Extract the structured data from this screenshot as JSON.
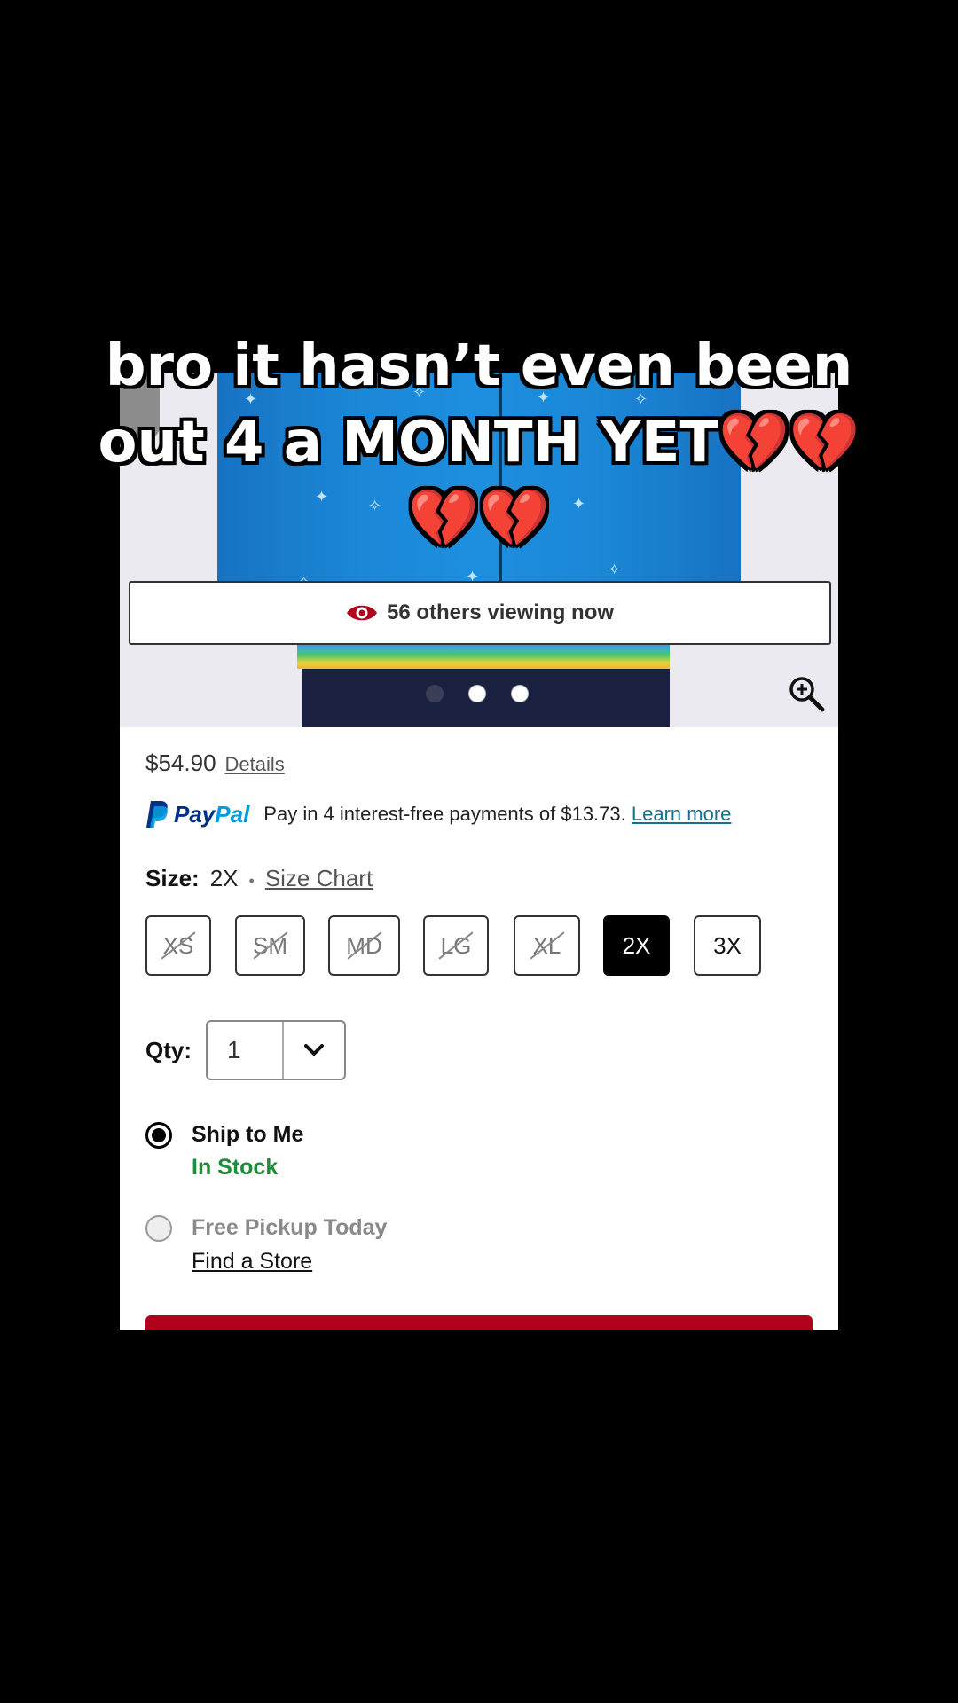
{
  "caption": {
    "line1": "bro it hasn’t even been",
    "line2": "out 4 a MONTH YET💔💔",
    "line3": "💔💔"
  },
  "product": {
    "viewers_text": "56 others viewing now",
    "price": "$54.90",
    "details_link": "Details",
    "paypal": {
      "wordmark_pay": "Pay",
      "wordmark_pal": "Pal",
      "text": "Pay in 4 interest-free payments of $13.73.",
      "learn_more": "Learn more"
    },
    "size": {
      "label": "Size:",
      "selected": "2X",
      "separator": "•",
      "chart_link": "Size Chart",
      "options": [
        {
          "label": "XS",
          "state": "disabled"
        },
        {
          "label": "SM",
          "state": "disabled"
        },
        {
          "label": "MD",
          "state": "disabled"
        },
        {
          "label": "LG",
          "state": "disabled"
        },
        {
          "label": "XL",
          "state": "disabled"
        },
        {
          "label": "2X",
          "state": "selected"
        },
        {
          "label": "3X",
          "state": "available"
        }
      ]
    },
    "qty": {
      "label": "Qty:",
      "value": "1"
    },
    "fulfillment": {
      "ship_label": "Ship to Me",
      "ship_status": "In Stock",
      "pickup_label": "Free Pickup Today",
      "find_store": "Find a Store"
    }
  },
  "colors": {
    "accent_red": "#b0001b",
    "in_stock_green": "#1e8c3a",
    "paypal_dark": "#003087",
    "paypal_light": "#009cde"
  }
}
